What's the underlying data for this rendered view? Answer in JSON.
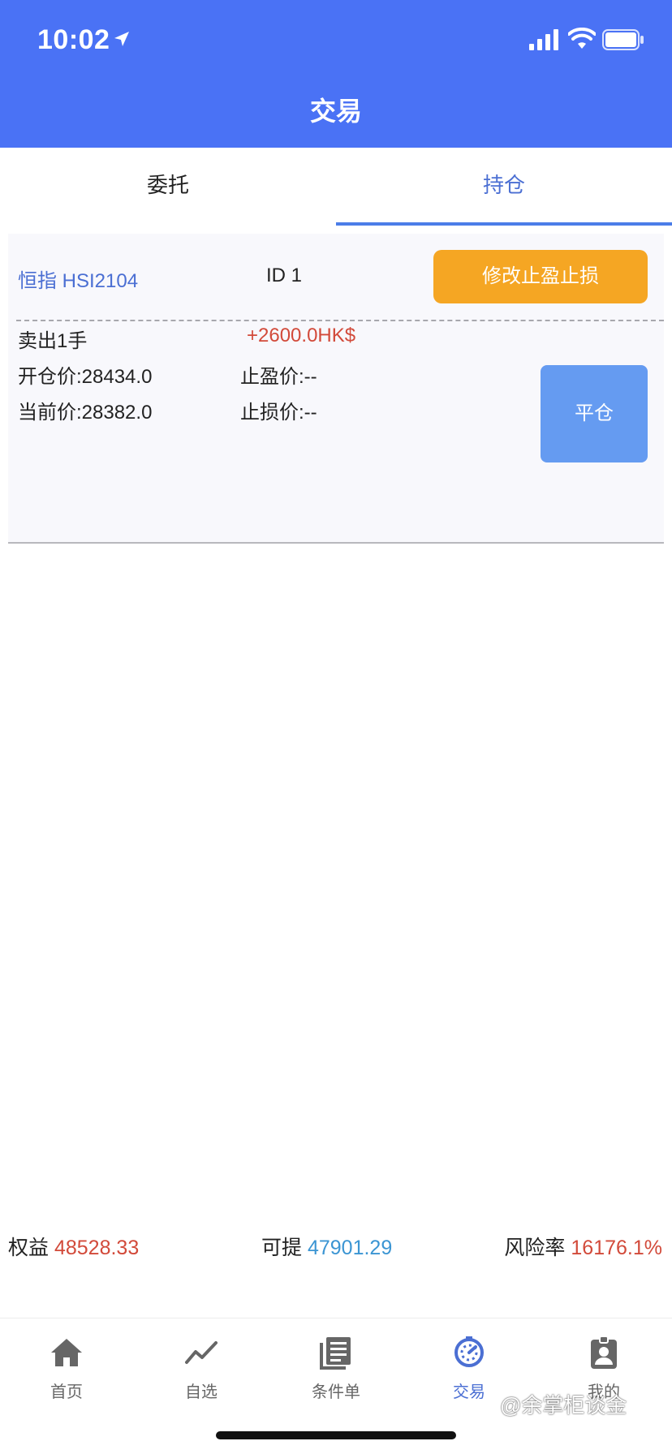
{
  "status_bar": {
    "time": "10:02"
  },
  "header": {
    "title": "交易"
  },
  "tabs": [
    {
      "label": "委托",
      "active": false
    },
    {
      "label": "持仓",
      "active": true
    }
  ],
  "position": {
    "symbol": "恒指 HSI2104",
    "id": "ID 1",
    "modify_button": "修改止盈止损",
    "side": "卖出1手",
    "pnl": "+2600.0HK$",
    "open_price": "开仓价:28434.0",
    "take_profit": "止盈价:--",
    "current_price": "当前价:28382.0",
    "stop_loss": "止损价:--",
    "close_button": "平仓"
  },
  "summary": {
    "equity_label": "权益",
    "equity_value": "48528.33",
    "available_label": "可提",
    "available_value": "47901.29",
    "risk_label": "风险率",
    "risk_value": "16176.1%"
  },
  "nav": [
    {
      "label": "首页",
      "icon": "home-icon"
    },
    {
      "label": "自选",
      "icon": "trend-icon"
    },
    {
      "label": "条件单",
      "icon": "document-icon"
    },
    {
      "label": "交易",
      "icon": "timer-icon",
      "active": true
    },
    {
      "label": "我的",
      "icon": "profile-badge-icon"
    }
  ],
  "watermark": "@余掌柜谈金",
  "colors": {
    "header_bg": "#4a72f5",
    "accent_blue": "#4b6fd3",
    "modify_button": "#f5a623",
    "close_button": "#659bf1",
    "profit_red": "#d24a3a",
    "available_blue": "#3b95d3"
  }
}
